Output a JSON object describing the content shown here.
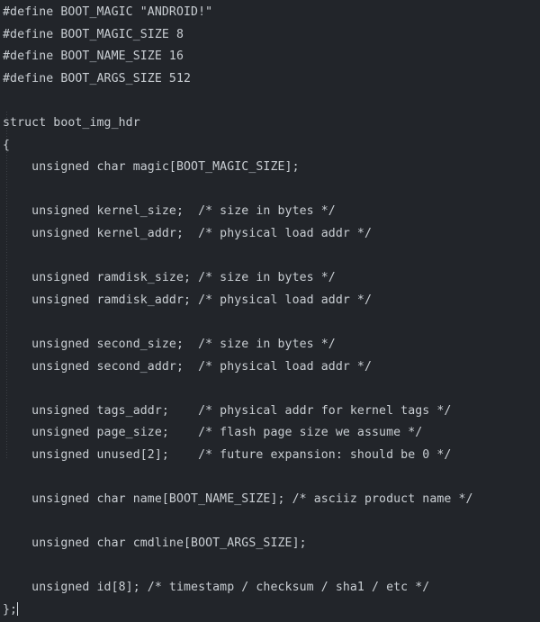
{
  "editor": {
    "background_color": "#22252a",
    "text_color": "#c9ced3",
    "indent_guide_color": "#3c4046",
    "caret_color": "#d8dde2",
    "language": "C",
    "filename_hint": "boot_img_hdr",
    "caret_line": 28,
    "caret_column": 3
  },
  "code": {
    "lines": [
      "#define BOOT_MAGIC \"ANDROID!\"",
      "#define BOOT_MAGIC_SIZE 8",
      "#define BOOT_NAME_SIZE 16",
      "#define BOOT_ARGS_SIZE 512",
      "",
      "struct boot_img_hdr",
      "{",
      "    unsigned char magic[BOOT_MAGIC_SIZE];",
      "",
      "    unsigned kernel_size;  /* size in bytes */",
      "    unsigned kernel_addr;  /* physical load addr */",
      "",
      "    unsigned ramdisk_size; /* size in bytes */",
      "    unsigned ramdisk_addr; /* physical load addr */",
      "",
      "    unsigned second_size;  /* size in bytes */",
      "    unsigned second_addr;  /* physical load addr */",
      "",
      "    unsigned tags_addr;    /* physical addr for kernel tags */",
      "    unsigned page_size;    /* flash page size we assume */",
      "    unsigned unused[2];    /* future expansion: should be 0 */",
      "",
      "    unsigned char name[BOOT_NAME_SIZE]; /* asciiz product name */",
      "",
      "    unsigned char cmdline[BOOT_ARGS_SIZE];",
      "",
      "    unsigned id[8]; /* timestamp / checksum / sha1 / etc */",
      "};"
    ],
    "defines": [
      {
        "name": "BOOT_MAGIC",
        "value": "\"ANDROID!\""
      },
      {
        "name": "BOOT_MAGIC_SIZE",
        "value": "8"
      },
      {
        "name": "BOOT_NAME_SIZE",
        "value": "16"
      },
      {
        "name": "BOOT_ARGS_SIZE",
        "value": "512"
      }
    ],
    "struct": {
      "name": "boot_img_hdr",
      "fields": [
        {
          "type": "unsigned char",
          "name": "magic[BOOT_MAGIC_SIZE]",
          "comment": ""
        },
        {
          "type": "unsigned",
          "name": "kernel_size",
          "comment": "/* size in bytes */"
        },
        {
          "type": "unsigned",
          "name": "kernel_addr",
          "comment": "/* physical load addr */"
        },
        {
          "type": "unsigned",
          "name": "ramdisk_size",
          "comment": "/* size in bytes */"
        },
        {
          "type": "unsigned",
          "name": "ramdisk_addr",
          "comment": "/* physical load addr */"
        },
        {
          "type": "unsigned",
          "name": "second_size",
          "comment": "/* size in bytes */"
        },
        {
          "type": "unsigned",
          "name": "second_addr",
          "comment": "/* physical load addr */"
        },
        {
          "type": "unsigned",
          "name": "tags_addr",
          "comment": "/* physical addr for kernel tags */"
        },
        {
          "type": "unsigned",
          "name": "page_size",
          "comment": "/* flash page size we assume */"
        },
        {
          "type": "unsigned",
          "name": "unused[2]",
          "comment": "/* future expansion: should be 0 */"
        },
        {
          "type": "unsigned char",
          "name": "name[BOOT_NAME_SIZE]",
          "comment": "/* asciiz product name */"
        },
        {
          "type": "unsigned char",
          "name": "cmdline[BOOT_ARGS_SIZE]",
          "comment": ""
        },
        {
          "type": "unsigned",
          "name": "id[8]",
          "comment": "/* timestamp / checksum / sha1 / etc */"
        }
      ]
    }
  }
}
